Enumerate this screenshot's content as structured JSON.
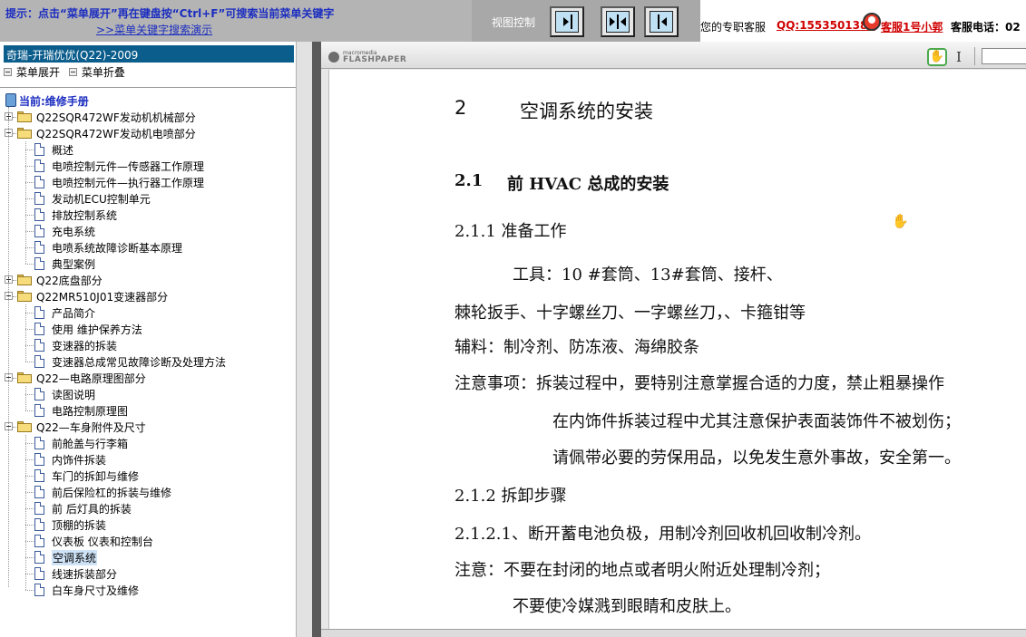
{
  "topbar": {
    "tip": "提示：点击“菜单展开”再在键盘按“Ctrl+F”可搜索当前菜单关键字",
    "tip_link": ">>菜单关键字搜索演示",
    "view_control_label": "视图控制",
    "view_buttons": [
      "fit-right-icon",
      "fit-both-icon",
      "fit-left-icon"
    ],
    "service_text": "您的专职客服",
    "service_qq": "QQ:1553501388",
    "service_name": "客服1号小郭",
    "service_phone": "客服电话：02"
  },
  "left_panel": {
    "header": "奇瑞-开瑞优优(Q22)-2009",
    "expand_label": "菜单展开",
    "collapse_label": "菜单折叠",
    "current_label": "当前:维修手册",
    "tree": [
      {
        "type": "folder",
        "state": "collapsed",
        "label": "Q22SQR472WF发动机机械部分"
      },
      {
        "type": "folder",
        "state": "expanded",
        "label": "Q22SQR472WF发动机电喷部分",
        "children": [
          "概述",
          "电喷控制元件—传感器工作原理",
          "电喷控制元件—执行器工作原理",
          "发动机ECU控制单元",
          "排放控制系统",
          "充电系统",
          "电喷系统故障诊断基本原理",
          "典型案例"
        ]
      },
      {
        "type": "folder",
        "state": "collapsed",
        "label": "Q22底盘部分"
      },
      {
        "type": "folder",
        "state": "expanded",
        "label": "Q22MR510J01变速器部分",
        "children": [
          "产品简介",
          "使用  维护保养方法",
          "变速器的拆装",
          "变速器总成常见故障诊断及处理方法"
        ]
      },
      {
        "type": "folder",
        "state": "expanded",
        "label": "Q22—电路原理图部分",
        "children": [
          "读图说明",
          "电路控制原理图"
        ]
      },
      {
        "type": "folder",
        "state": "expanded",
        "label": "Q22—车身附件及尺寸",
        "children": [
          "前舱盖与行李箱",
          "内饰件拆装",
          "车门的拆卸与维修",
          "前后保险杠的拆装与维修",
          "前  后灯具的拆装",
          "顶棚的拆装",
          "仪表板  仪表和控制台",
          "空调系统",
          "线速拆装部分",
          "白车身尺寸及维修"
        ]
      }
    ],
    "selected": "空调系统"
  },
  "viewer": {
    "logo_small": "macromedia",
    "logo_big": "FLASHPAPER",
    "tools": [
      "hand-tool-icon",
      "text-select-icon"
    ],
    "page": {
      "section_number": "2",
      "section_title": "空调系统的安装",
      "subsection_number": "2.1",
      "subsection_title": "前 HVAC 总成的安装",
      "lines": [
        "2.1.1 准备工作",
        "工具：10 #套筒、13#套筒、接杆、",
        "棘轮扳手、十字螺丝刀、一字螺丝刀，、卡箍钳等",
        "辅料：制冷剂、防冻液、海绵胶条",
        "注意事项：拆装过程中，要特别注意掌握合适的力度，禁止粗暴操作",
        "在内饰件拆装过程中尤其注意保护表面装饰件不被划伤；",
        "请佩带必要的劳保用品，以免发生意外事故，安全第一。",
        "2.1.2 拆卸步骤",
        "2.1.2.1、断开蓄电池负极，用制冷剂回收机回收制冷剂。",
        "注意：不要在封闭的地点或者明火附近处理制冷剂；",
        "不要使冷媒溅到眼睛和皮肤上。"
      ]
    }
  }
}
